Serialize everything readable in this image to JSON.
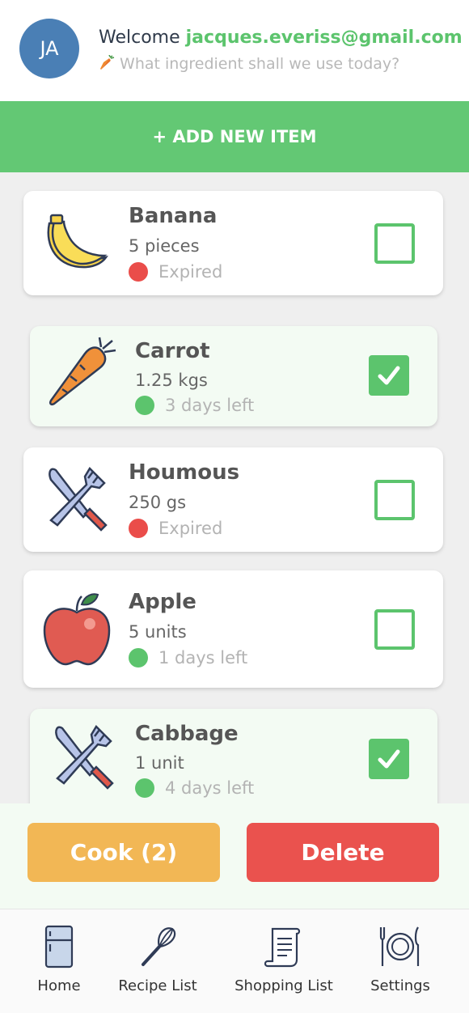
{
  "header": {
    "avatar_initials": "JA",
    "welcome_prefix": "Welcome",
    "email": "jacques.everiss@gmail.com",
    "subtitle_icon": "carrot-icon",
    "subtitle": "What ingredient shall we use today?"
  },
  "add_button_label": "+ ADD NEW ITEM",
  "items": [
    {
      "name": "Banana",
      "quantity": "5 pieces",
      "status": "Expired",
      "status_color": "#ea4d4a",
      "checked": false,
      "icon": "banana-icon"
    },
    {
      "name": "Carrot",
      "quantity": "1.25 kgs",
      "status": "3 days left",
      "status_color": "#5cc46d",
      "checked": true,
      "icon": "carrot-icon"
    },
    {
      "name": "Houmous",
      "quantity": "250 gs",
      "status": "Expired",
      "status_color": "#ea4d4a",
      "checked": false,
      "icon": "cutlery-icon"
    },
    {
      "name": "Apple",
      "quantity": "5 units",
      "status": "1 days left",
      "status_color": "#5cc46d",
      "checked": false,
      "icon": "apple-icon"
    },
    {
      "name": "Cabbage",
      "quantity": "1 unit",
      "status": "4 days left",
      "status_color": "#5cc46d",
      "checked": true,
      "icon": "cutlery-icon"
    }
  ],
  "actions": {
    "cook_label": "Cook (2)",
    "delete_label": "Delete"
  },
  "tabs": [
    {
      "label": "Home",
      "icon": "fridge-icon"
    },
    {
      "label": "Recipe List",
      "icon": "whisk-icon"
    },
    {
      "label": "Shopping List",
      "icon": "list-scroll-icon"
    },
    {
      "label": "Settings",
      "icon": "plate-cutlery-icon"
    }
  ],
  "colors": {
    "accent_green": "#63c874",
    "cook_orange": "#f2b755",
    "delete_red": "#ea524e",
    "avatar_blue": "#4a7fb5"
  }
}
